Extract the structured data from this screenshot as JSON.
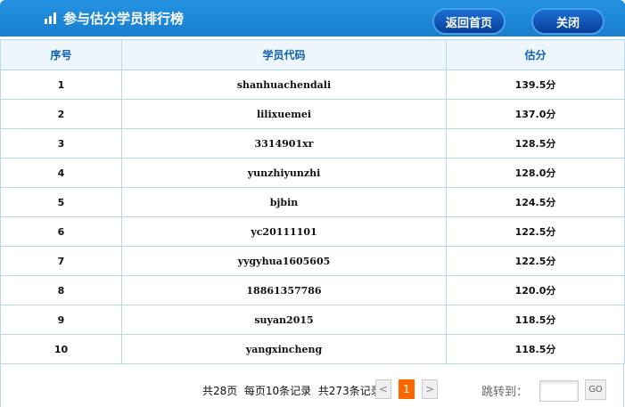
{
  "header": {
    "title": "参与估分学员排行榜",
    "home_button": "返回首页",
    "close_button": "关闭"
  },
  "table": {
    "columns": [
      "序号",
      "学员代码",
      "估分"
    ],
    "rows": [
      [
        "1",
        "shanhuachendali",
        "139.5分"
      ],
      [
        "2",
        "lilixuemei",
        "137.0分"
      ],
      [
        "3",
        "3314901xr",
        "128.5分"
      ],
      [
        "4",
        "yunzhiyunzhi",
        "128.0分"
      ],
      [
        "5",
        "bjbin",
        "124.5分"
      ],
      [
        "6",
        "yc20111101",
        "122.5分"
      ],
      [
        "7",
        "yygyhua1605605",
        "122.5分"
      ],
      [
        "8",
        "18861357786",
        "120.0分"
      ],
      [
        "9",
        "suyan2015",
        "118.5分"
      ],
      [
        "10",
        "yangxincheng",
        "118.5分"
      ]
    ]
  },
  "pagination": {
    "info": "共28页  每页10条记录  共273条记录",
    "prev": "<",
    "current": "1",
    "next": ">",
    "jump_label": "跳转到：",
    "jump_value": "",
    "go": "GO"
  }
}
